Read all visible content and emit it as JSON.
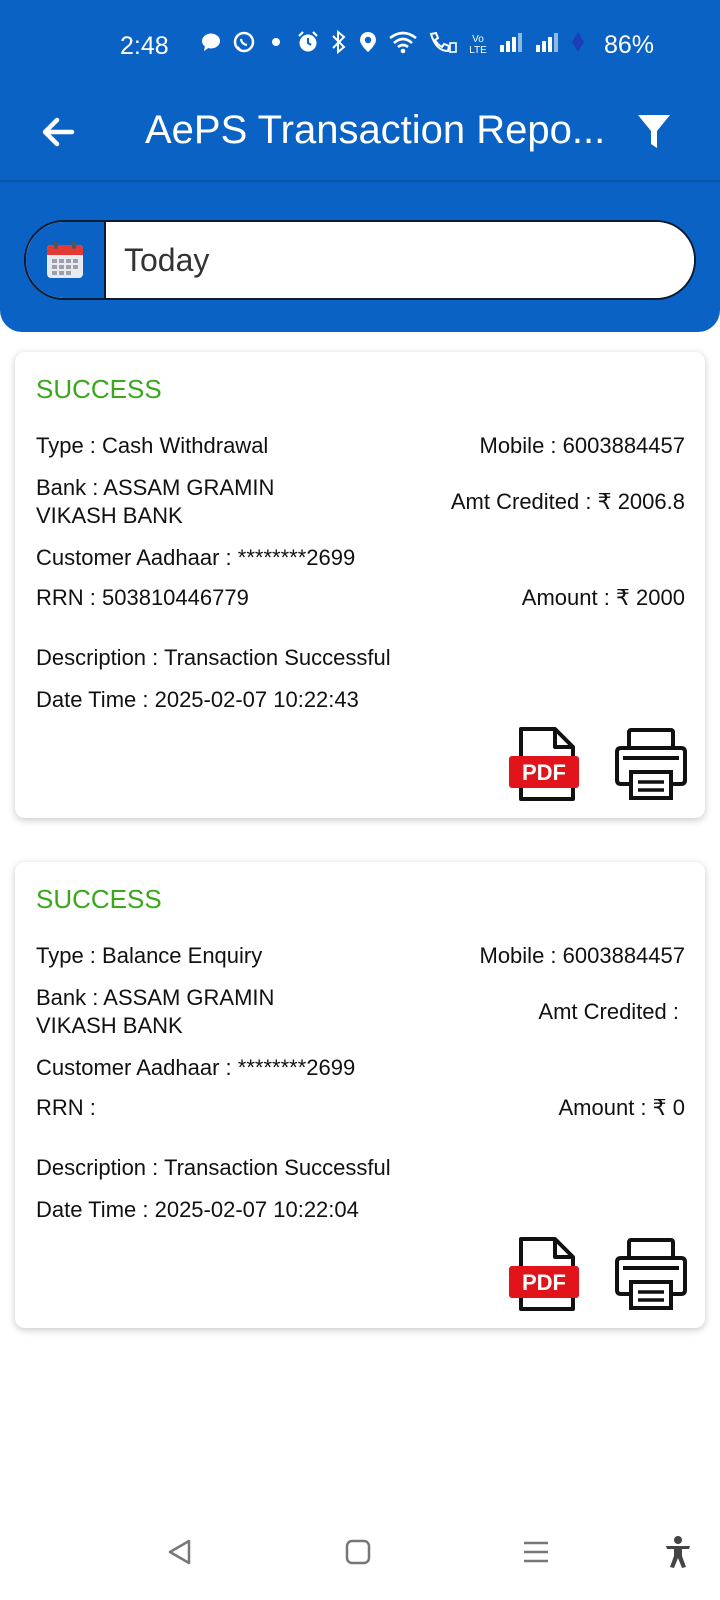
{
  "status_bar": {
    "time": "2:48",
    "battery": "86%",
    "icons": [
      "chat-icon",
      "whatsapp-icon",
      "dot-icon",
      "alarm-icon",
      "bluetooth-icon",
      "location-icon",
      "wifi-icon",
      "wifi-call-icon",
      "volte-icon",
      "signal-icon",
      "signal-icon",
      "data-icon"
    ],
    "volte_label": "Vo LTE"
  },
  "toolbar": {
    "title": "AePS Transaction Repo...",
    "back_icon": "arrow-left-icon",
    "filter_icon": "filter-icon"
  },
  "date_filter": {
    "value": "Today",
    "icon": "calendar-icon"
  },
  "transactions": [
    {
      "status": "SUCCESS",
      "type": "Type : Cash Withdrawal",
      "mobile": "Mobile : 6003884457",
      "bank_line1": "Bank : ASSAM GRAMIN",
      "bank_line2": "VIKASH BANK",
      "amt_credited": "Amt Credited : ₹ 2006.8",
      "aadhaar": "Customer Aadhaar : ********2699",
      "rrn": "RRN : 503810446779",
      "amount": "Amount : ₹ 2000",
      "description": "Description : Transaction Successful",
      "datetime": "Date Time : 2025-02-07 10:22:43",
      "pdf_label": "PDF"
    },
    {
      "status": "SUCCESS",
      "type": "Type : Balance Enquiry",
      "mobile": "Mobile : 6003884457",
      "bank_line1": "Bank : ASSAM GRAMIN",
      "bank_line2": "VIKASH BANK",
      "amt_credited": "Amt Credited :",
      "aadhaar": "Customer Aadhaar : ********2699",
      "rrn": "RRN :",
      "amount": "Amount : ₹ 0",
      "description": "Description : Transaction Successful",
      "datetime": "Date Time : 2025-02-07 10:22:04",
      "pdf_label": "PDF"
    }
  ],
  "colors": {
    "header_blue": "#0a63c4",
    "success_green": "#3aa81c",
    "pdf_red": "#e0141a"
  },
  "nav_bar": {
    "icons": [
      "back-triangle-icon",
      "home-square-icon",
      "recents-menu-icon",
      "accessibility-icon"
    ]
  }
}
